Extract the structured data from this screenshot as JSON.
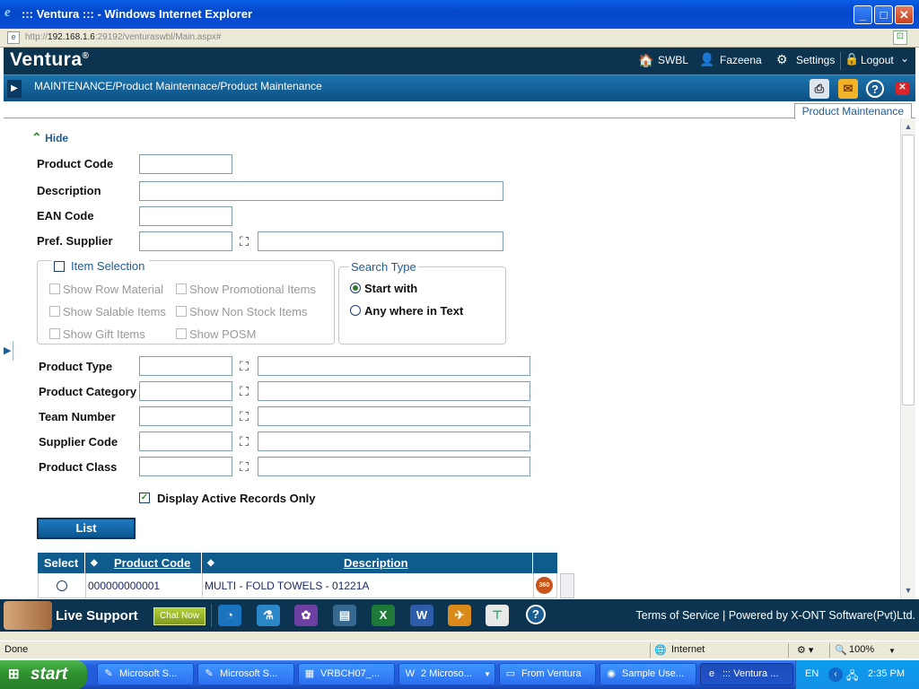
{
  "window": {
    "title": "::: Ventura ::: - Windows Internet Explorer",
    "url_prefix": "http://",
    "url_host": "192.168.1.6",
    "url_rest": ":29192/venturaswbl/Main.aspx#"
  },
  "app": {
    "logo": "Ventura",
    "registered": "®",
    "company": "SWBL",
    "user": "Fazeena",
    "settings": "Settings",
    "logout": "Logout"
  },
  "breadcrumb": "MAINTENANCE/Product Maintennace/Product Maintenance",
  "active_tab": "Product Maintenance",
  "form": {
    "hide_label": "Hide",
    "product_code": {
      "label": "Product Code",
      "value": ""
    },
    "description": {
      "label": "Description",
      "value": ""
    },
    "ean_code": {
      "label": "EAN Code",
      "value": ""
    },
    "pref_supplier": {
      "label": "Pref. Supplier",
      "code": "",
      "name": ""
    },
    "item_selection": {
      "title": "Item Selection",
      "checked": false,
      "options": [
        {
          "label": "Show Row Material",
          "checked": false
        },
        {
          "label": "Show Promotional Items",
          "checked": false
        },
        {
          "label": "Show Salable Items",
          "checked": false
        },
        {
          "label": "Show Non Stock Items",
          "checked": false
        },
        {
          "label": "Show Gift Items",
          "checked": false
        },
        {
          "label": "Show POSM",
          "checked": false
        }
      ]
    },
    "search_type": {
      "title": "Search Type",
      "options": [
        {
          "label": "Start with",
          "selected": true
        },
        {
          "label": "Any where in Text",
          "selected": false
        }
      ]
    },
    "lookups": [
      {
        "label": "Product Type",
        "code": "",
        "name": ""
      },
      {
        "label": "Product Category",
        "code": "",
        "name": ""
      },
      {
        "label": "Team Number",
        "code": "",
        "name": ""
      },
      {
        "label": "Supplier Code",
        "code": "",
        "name": ""
      },
      {
        "label": "Product Class",
        "code": "",
        "name": ""
      }
    ],
    "active_only": {
      "label": "Display Active Records Only",
      "checked": true
    },
    "list_button": "List"
  },
  "grid": {
    "headers": {
      "select": "Select",
      "product_code": "Product Code",
      "description": "Description"
    },
    "rows": [
      {
        "product_code": "000000000001",
        "description": "MULTI - FOLD TOWELS - 01221A",
        "badge": "360"
      }
    ]
  },
  "live_support": {
    "label": "Live Support",
    "chat": "Chat Now",
    "footer": "Terms of Service | Powered by X-ONT Software(Pvt)Ltd."
  },
  "statusbar": {
    "status": "Done",
    "zone": "Internet",
    "zoom": "100%"
  },
  "taskbar": {
    "start": "start",
    "tasks": [
      {
        "label": "Microsoft S..."
      },
      {
        "label": "Microsoft S..."
      },
      {
        "label": "VRBCH07_..."
      },
      {
        "label": "2 Microso..."
      },
      {
        "label": "From Ventura"
      },
      {
        "label": "Sample Use..."
      },
      {
        "label": "::: Ventura ..."
      }
    ],
    "lang": "EN",
    "time": "2:35 PM"
  }
}
